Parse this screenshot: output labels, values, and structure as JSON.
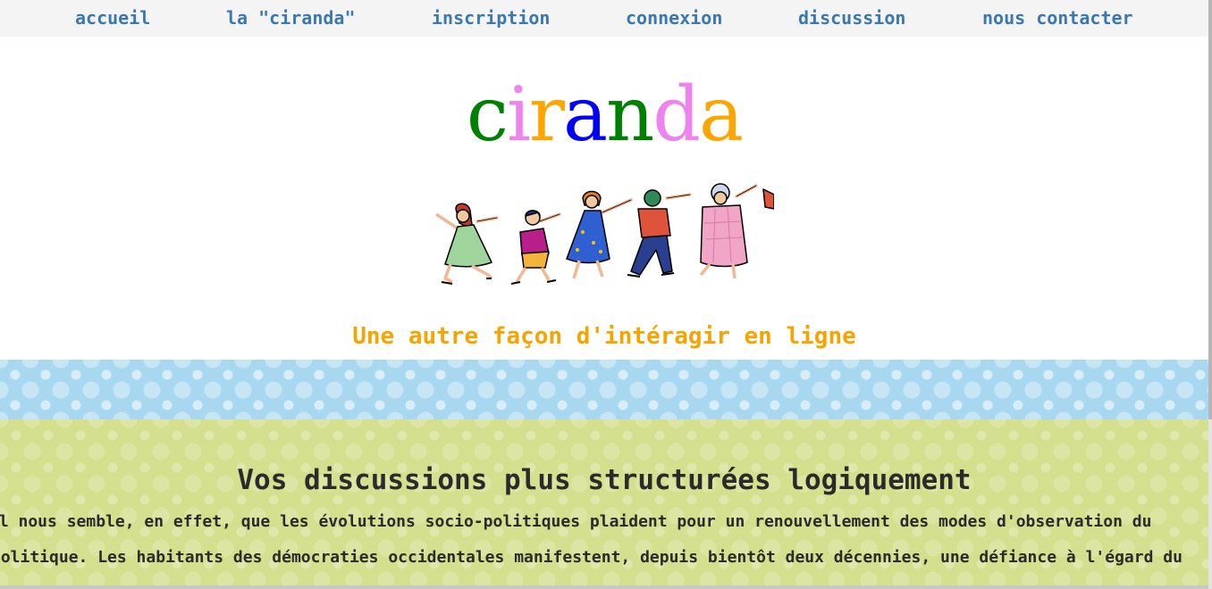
{
  "nav": {
    "items": [
      {
        "label": "accueil"
      },
      {
        "label": "la \"ciranda\""
      },
      {
        "label": "inscription"
      },
      {
        "label": "connexion"
      },
      {
        "label": "discussion"
      },
      {
        "label": "nous contacter"
      }
    ]
  },
  "header": {
    "logo_letters": [
      {
        "char": "c",
        "color": "#008000"
      },
      {
        "char": "i",
        "color": "#ee82ee"
      },
      {
        "char": "r",
        "color": "#ffa500"
      },
      {
        "char": "a",
        "color": "#0000ff"
      },
      {
        "char": "n",
        "color": "#008000"
      },
      {
        "char": "d",
        "color": "#ee82ee"
      },
      {
        "char": "a",
        "color": "#ffa500"
      }
    ],
    "tagline": "Une autre façon d'intéragir en ligne"
  },
  "section": {
    "title": "Vos discussions plus structurées logiquement",
    "lines": [
      "Il nous semble, en effet, que les évolutions socio-politiques plaident pour un renouvellement des modes d'observation du",
      "politique. Les habitants des démocraties occidentales manifestent, depuis bientôt deux décennies, une défiance à l'égard du"
    ]
  },
  "colors": {
    "nav_link": "#3a78b0",
    "tagline": "#f7a400",
    "band_blue": "#a8d8ef",
    "band_green": "#d4e08e"
  }
}
